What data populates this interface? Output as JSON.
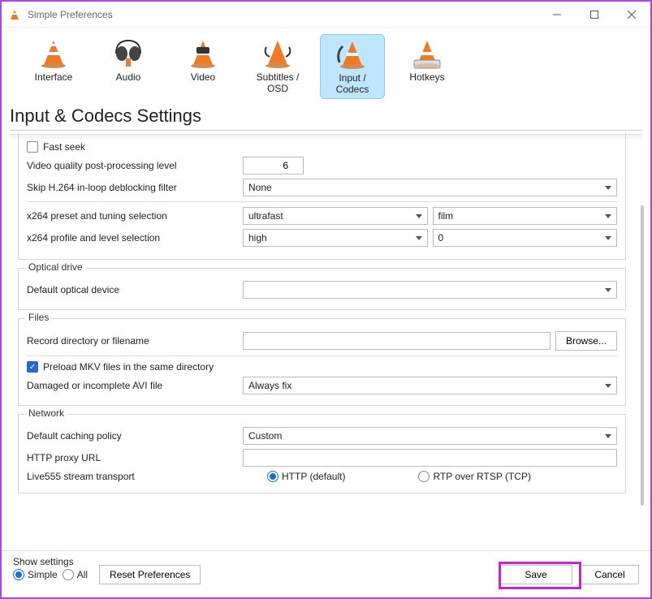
{
  "window": {
    "title": "Simple Preferences"
  },
  "tabs": [
    {
      "label": "Interface"
    },
    {
      "label": "Audio"
    },
    {
      "label": "Video"
    },
    {
      "label": "Subtitles / OSD"
    },
    {
      "label": "Input / Codecs"
    },
    {
      "label": "Hotkeys"
    }
  ],
  "heading": "Input & Codecs Settings",
  "codecs": {
    "fast_seek_label": "Fast seek",
    "video_quality_label": "Video quality post-processing level",
    "video_quality_value": "6",
    "skip_deblock_label": "Skip H.264 in-loop deblocking filter",
    "skip_deblock_value": "None",
    "x264_preset_label": "x264 preset and tuning selection",
    "x264_preset_value": "ultrafast",
    "x264_tuning_value": "film",
    "x264_profile_label": "x264 profile and level selection",
    "x264_profile_value": "high",
    "x264_level_value": "0"
  },
  "optical": {
    "legend": "Optical drive",
    "default_device_label": "Default optical device",
    "default_device_value": ""
  },
  "files": {
    "legend": "Files",
    "record_dir_label": "Record directory or filename",
    "record_dir_value": "",
    "browse_label": "Browse...",
    "preload_mkv_label": "Preload MKV files in the same directory",
    "avi_label": "Damaged or incomplete AVI file",
    "avi_value": "Always fix"
  },
  "network": {
    "legend": "Network",
    "caching_label": "Default caching policy",
    "caching_value": "Custom",
    "proxy_label": "HTTP proxy URL",
    "proxy_value": "",
    "live555_label": "Live555 stream transport",
    "live555_http": "HTTP (default)",
    "live555_rtp": "RTP over RTSP (TCP)"
  },
  "footer": {
    "show_settings": "Show settings",
    "simple": "Simple",
    "all": "All",
    "reset": "Reset Preferences",
    "save": "Save",
    "cancel": "Cancel"
  }
}
